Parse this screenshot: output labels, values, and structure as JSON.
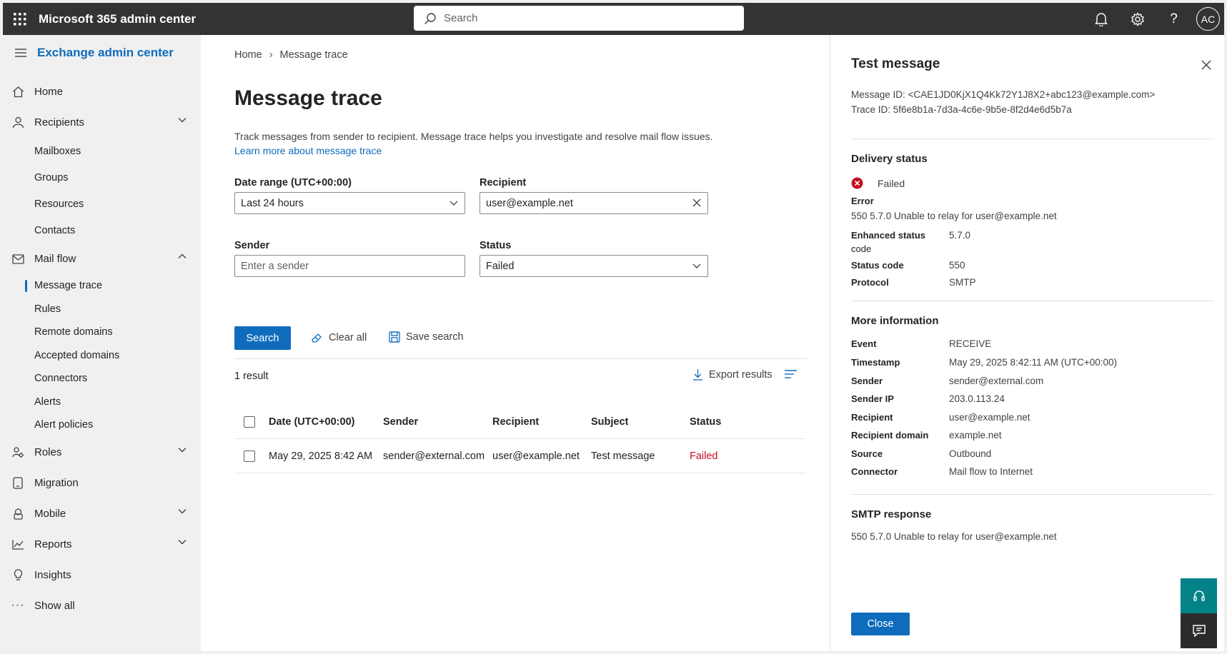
{
  "app": {
    "title": "Microsoft 365 admin center",
    "search_placeholder": "Search",
    "avatar_initials": "AC"
  },
  "sidebar": {
    "title": "Exchange admin center",
    "home": "Home",
    "recipients": "Recipients",
    "recipients_sub": [
      "Mailboxes",
      "Groups",
      "Resources",
      "Contacts"
    ],
    "mail_flow": "Mail flow",
    "mail_flow_sub": [
      "Message trace",
      "Rules",
      "Remote domains",
      "Accepted domains",
      "Connectors",
      "Alerts",
      "Alert policies"
    ],
    "roles": "Roles",
    "migration": "Migration",
    "mobile": "Mobile",
    "reports": "Reports",
    "insights": "Insights",
    "show_all": "Show all"
  },
  "main": {
    "breadcrumb": [
      "Home",
      "Message trace"
    ],
    "title": "Message trace",
    "description": "Track messages from sender to recipient. Message trace helps you investigate and resolve mail flow issues.",
    "learn_more": "Learn more about message trace",
    "date_range_label": "Date range (UTC+00:00)",
    "date_range_value": "Last 24 hours",
    "recipient_label": "Recipient",
    "recipient_value": "user@example.net",
    "sender_label": "Sender",
    "sender_placeholder": "Enter a sender",
    "status_label": "Status",
    "status_value": "Failed",
    "search_button": "Search",
    "clear_all": "Clear all",
    "save_search": "Save search",
    "results_count": "1 result",
    "export_results": "Export results",
    "table": {
      "columns": [
        "Date (UTC+00:00)",
        "Sender",
        "Recipient",
        "Subject",
        "Status"
      ],
      "rows": [
        {
          "date": "May 29, 2025 8:42 AM",
          "sender": "sender@external.com",
          "recipient": "user@example.net",
          "subject": "Test message",
          "status": "Failed"
        }
      ]
    }
  },
  "panel": {
    "title": "Test message",
    "message_id": "Message ID: <CAE1JD0KjX1Q4Kk72Y1J8X2+abc123@example.com>",
    "trace_id": "Trace ID: 5f6e8b1a-7d3a-4c6e-9b5e-8f2d4e6d5b7a",
    "delivery_status_title": "Delivery status",
    "delivery_status": "Failed",
    "error_label": "Error",
    "error_value": "550 5.7.0 Unable to relay for user@example.net",
    "enhanced_status_label_1": "Enhanced status",
    "enhanced_status_label_2": "code",
    "enhanced_status_value": "5.7.0",
    "status_code_label": "Status code",
    "status_code_value": "550",
    "protocol_label": "Protocol",
    "protocol_value": "SMTP",
    "more_info_title": "More information",
    "more_info": [
      {
        "key": "Event",
        "value": "RECEIVE"
      },
      {
        "key": "Timestamp",
        "value": "May 29, 2025 8:42:11 AM (UTC+00:00)"
      },
      {
        "key": "Sender",
        "value": "sender@external.com"
      },
      {
        "key": "Sender IP",
        "value": "203.0.113.24"
      },
      {
        "key": "Recipient",
        "value": "user@example.net"
      },
      {
        "key": "Recipient domain",
        "value": "example.net"
      },
      {
        "key": "Source",
        "value": "Outbound"
      },
      {
        "key": "Connector",
        "value": "Mail flow to Internet"
      }
    ],
    "smtp_title": "SMTP response",
    "smtp_value": "550 5.7.0 Unable to relay for user@example.net",
    "close_button": "Close"
  },
  "colors": {
    "accent": "#0f6cbd",
    "topbar": "#333333",
    "error": "#c50f1f",
    "support": "#038387"
  }
}
